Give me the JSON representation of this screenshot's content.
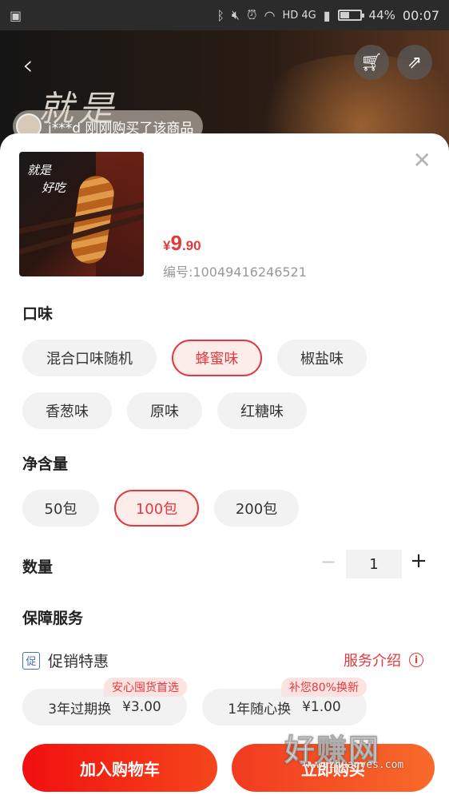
{
  "status_bar": {
    "network": "HD 4G",
    "battery": "44%",
    "battery_level": 0.44,
    "time": "00:07"
  },
  "header": {
    "banner_text": "就是",
    "buyer_note": "j***d 刚刚购买了该商品"
  },
  "product": {
    "thumb_line1": "就是",
    "thumb_line2": "好吃",
    "price_currency": "¥",
    "price_int": "9",
    "price_dec": ".90",
    "sku_number": "编号:10049416246521"
  },
  "flavor": {
    "title": "口味",
    "options": [
      "混合口味随机",
      "蜂蜜味",
      "椒盐味",
      "香葱味",
      "原味",
      "红糖味"
    ],
    "selected": "蜂蜜味"
  },
  "net_weight": {
    "title": "净含量",
    "options": [
      "50包",
      "100包",
      "200包"
    ],
    "selected": "100包"
  },
  "quantity": {
    "title": "数量",
    "minus": "−",
    "value": "1",
    "plus": "+"
  },
  "guarantee": {
    "title": "保障服务",
    "promo_icon": "促",
    "promo_label": "促销特惠",
    "intro_label": "服务介绍",
    "intro_icon": "i",
    "services": [
      {
        "name": "3年过期换",
        "price": "¥3.00",
        "tag": "安心囤货首选"
      },
      {
        "name": "1年随心换",
        "price": "¥1.00",
        "tag": "补您80%换新"
      }
    ]
  },
  "actions": {
    "add_to_cart": "加入购物车",
    "buy_now": "立即购买"
  },
  "watermark": {
    "big": "好赚网",
    "small": "www.zhuanyes.com"
  },
  "icons": {
    "back": "chevron-left-icon",
    "cart": "cart-icon",
    "share": "share-icon",
    "close": "close-icon"
  },
  "colors": {
    "accent": "#e4393c",
    "chip_bg": "#f2f2f2",
    "selected_bg": "#fcedeb"
  }
}
